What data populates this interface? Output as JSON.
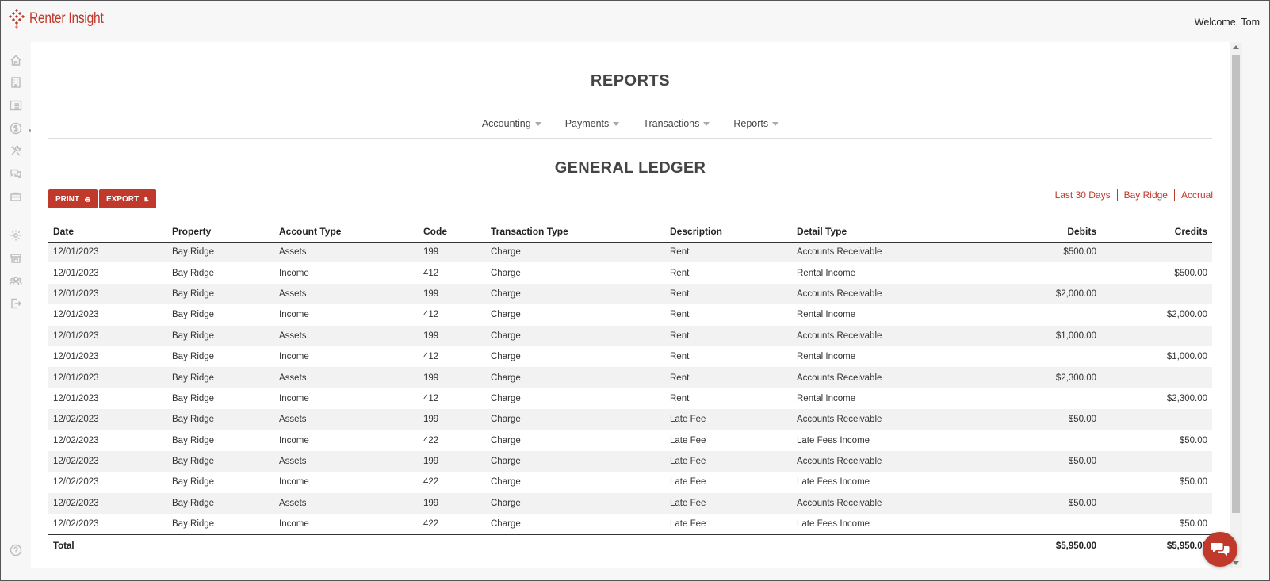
{
  "header": {
    "brand": "Renter Insight",
    "welcome": "Welcome, Tom",
    "accent_color": "#c0392b"
  },
  "sidebar": {
    "icons": [
      "home-icon",
      "building-icon",
      "list-icon",
      "dollar-icon",
      "tools-icon",
      "chat-icon",
      "briefcase-icon",
      "gear-icon",
      "store-icon",
      "users-icon",
      "logout-icon",
      "help-icon"
    ]
  },
  "page": {
    "title": "REPORTS"
  },
  "nav": {
    "items": [
      {
        "label": "Accounting"
      },
      {
        "label": "Payments"
      },
      {
        "label": "Transactions"
      },
      {
        "label": "Reports"
      }
    ]
  },
  "report": {
    "title": "GENERAL LEDGER",
    "print_label": "PRINT",
    "export_label": "EXPORT",
    "filters": [
      "Last 30 Days",
      "Bay Ridge",
      "Accrual"
    ]
  },
  "table": {
    "columns": [
      "Date",
      "Property",
      "Account Type",
      "Code",
      "Transaction Type",
      "Description",
      "Detail Type",
      "Debits",
      "Credits"
    ],
    "rows": [
      [
        "12/01/2023",
        "Bay Ridge",
        "Assets",
        "199",
        "Charge",
        "Rent",
        "Accounts Receivable",
        "$500.00",
        ""
      ],
      [
        "12/01/2023",
        "Bay Ridge",
        "Income",
        "412",
        "Charge",
        "Rent",
        "Rental Income",
        "",
        "$500.00"
      ],
      [
        "12/01/2023",
        "Bay Ridge",
        "Assets",
        "199",
        "Charge",
        "Rent",
        "Accounts Receivable",
        "$2,000.00",
        ""
      ],
      [
        "12/01/2023",
        "Bay Ridge",
        "Income",
        "412",
        "Charge",
        "Rent",
        "Rental Income",
        "",
        "$2,000.00"
      ],
      [
        "12/01/2023",
        "Bay Ridge",
        "Assets",
        "199",
        "Charge",
        "Rent",
        "Accounts Receivable",
        "$1,000.00",
        ""
      ],
      [
        "12/01/2023",
        "Bay Ridge",
        "Income",
        "412",
        "Charge",
        "Rent",
        "Rental Income",
        "",
        "$1,000.00"
      ],
      [
        "12/01/2023",
        "Bay Ridge",
        "Assets",
        "199",
        "Charge",
        "Rent",
        "Accounts Receivable",
        "$2,300.00",
        ""
      ],
      [
        "12/01/2023",
        "Bay Ridge",
        "Income",
        "412",
        "Charge",
        "Rent",
        "Rental Income",
        "",
        "$2,300.00"
      ],
      [
        "12/02/2023",
        "Bay Ridge",
        "Assets",
        "199",
        "Charge",
        "Late Fee",
        "Accounts Receivable",
        "$50.00",
        ""
      ],
      [
        "12/02/2023",
        "Bay Ridge",
        "Income",
        "422",
        "Charge",
        "Late Fee",
        "Late Fees Income",
        "",
        "$50.00"
      ],
      [
        "12/02/2023",
        "Bay Ridge",
        "Assets",
        "199",
        "Charge",
        "Late Fee",
        "Accounts Receivable",
        "$50.00",
        ""
      ],
      [
        "12/02/2023",
        "Bay Ridge",
        "Income",
        "422",
        "Charge",
        "Late Fee",
        "Late Fees Income",
        "",
        "$50.00"
      ],
      [
        "12/02/2023",
        "Bay Ridge",
        "Assets",
        "199",
        "Charge",
        "Late Fee",
        "Accounts Receivable",
        "$50.00",
        ""
      ],
      [
        "12/02/2023",
        "Bay Ridge",
        "Income",
        "422",
        "Charge",
        "Late Fee",
        "Late Fees Income",
        "",
        "$50.00"
      ]
    ],
    "total": {
      "label": "Total",
      "debits": "$5,950.00",
      "credits": "$5,950.00"
    }
  }
}
